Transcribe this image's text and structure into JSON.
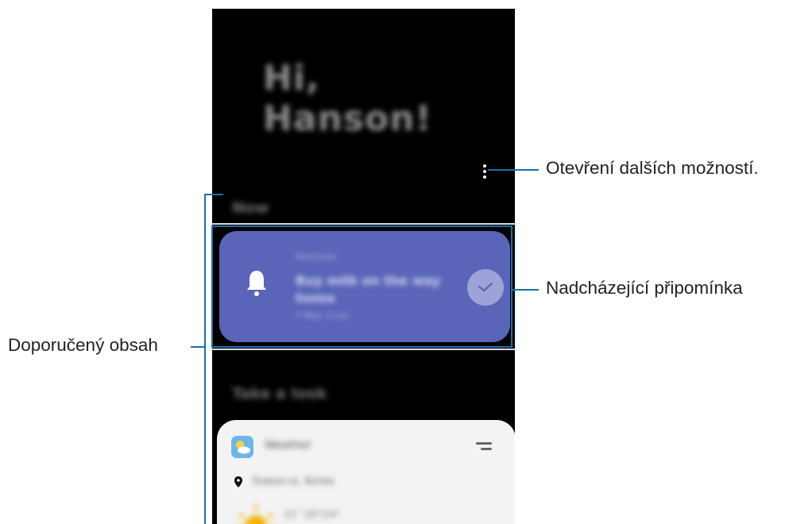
{
  "screen": {
    "greeting": "Hi, Hanson!",
    "sections": {
      "now": "Now",
      "take_a_look": "Take a look"
    },
    "reminder_card": {
      "caption": "Reminder",
      "title": "Buy milk on the way home",
      "time": "7 May, 6 pm",
      "icon": "bell-icon",
      "action_icon": "check-icon",
      "color": "#5a64b8"
    },
    "weather_card": {
      "app_name": "Weather",
      "location": "Suwon-si, Korea",
      "temperature": "21° 18°/24°",
      "icon": "weather-icon"
    },
    "menu_icon": "more-options-icon"
  },
  "callouts": {
    "more_options": "Otevření dalších možností.",
    "upcoming_reminder": "Nadcházející připomínka",
    "recommended_content": "Doporučený obsah",
    "line_color": "#1a6fa6"
  }
}
